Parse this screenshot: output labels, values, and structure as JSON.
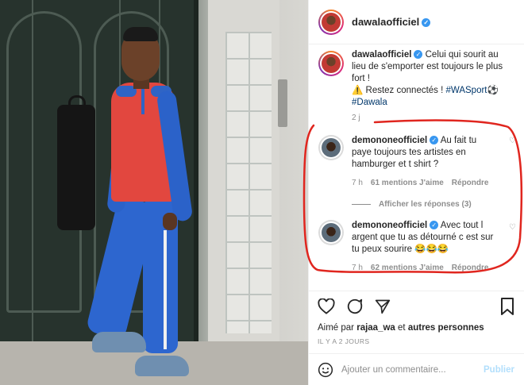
{
  "post": {
    "username": "dawalaofficiel",
    "caption_lines": [
      "Celui qui sourit au",
      "lieu de s'emporter est toujours le plus",
      "fort !"
    ],
    "caption_second_prefix": "⚠️ Restez connectés ! ",
    "hashtag_1": "#WASport⚽",
    "hashtag_2": "#Dawala",
    "time": "2 j"
  },
  "comments": [
    {
      "username": "demononeofficiel",
      "text_lines": [
        "Au fait tu",
        "paye toujours tes artistes en",
        "hamburger et t shirt ?"
      ],
      "time": "7 h",
      "likes": "61 mentions J'aime",
      "reply": "Répondre"
    },
    {
      "username": "demononeofficiel",
      "text_lines": [
        "Avec tout l",
        "argent que tu as détourné c est sur",
        "tu peux sourire 😂😂😂"
      ],
      "time": "7 h",
      "likes": "62 mentions J'aime",
      "reply": "Répondre"
    }
  ],
  "view_replies": "Afficher les réponses (3)",
  "likes_line": {
    "prefix": "Aimé par ",
    "user": "rajaa_wa",
    "middle": " et ",
    "others": "autres personnes"
  },
  "date": "IL Y A 2 JOURS",
  "add_comment": {
    "placeholder": "Ajouter un commentaire...",
    "publish": "Publier"
  },
  "colors": {
    "verified": "#3897f0",
    "hashtag": "#00376b",
    "annotation": "#e0261f",
    "publish": "#b2dffc"
  }
}
